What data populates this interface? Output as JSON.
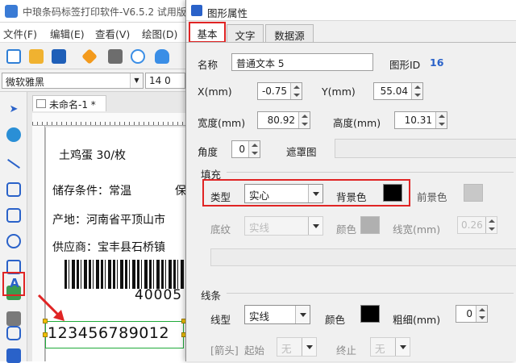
{
  "app": {
    "title": "中琅条码标签打印软件-V6.5.2 试用版",
    "menu": [
      "文件(F)",
      "编辑(E)",
      "查看(V)",
      "绘图(D)"
    ],
    "font_name": "微软雅黑",
    "font_size": "14 0",
    "doc_tab": "未命名-1 *",
    "label": {
      "line1": "土鸡蛋  30/枚",
      "line2": "储存条件：常温",
      "line2b": "保",
      "line3": "产地：河南省平顶山市",
      "line4": "供应商：宝丰县石桥镇",
      "barcode_digits": "40005",
      "selected_text": "123456789012"
    }
  },
  "dialog": {
    "title": "图形属性",
    "tabs": [
      "基本",
      "文字",
      "数据源"
    ],
    "name_label": "名称",
    "name_value": "普通文本 5",
    "id_label": "图形ID",
    "id_value": "16",
    "x_label": "X(mm)",
    "x_value": "-0.75",
    "y_label": "Y(mm)",
    "y_value": "55.04",
    "width_label": "宽度(mm)",
    "width_value": "80.92",
    "height_label": "高度(mm)",
    "height_value": "10.31",
    "angle_label": "角度",
    "angle_value": "0",
    "mask_label": "遮罩图",
    "fill_group": "填充",
    "fill_type_label": "类型",
    "fill_type_value": "实心",
    "bg_color_label": "背景色",
    "fg_color_label": "前景色",
    "pattern_label": "底纹",
    "pattern_value": "实线",
    "pattern_color_label": "颜色",
    "line_width_label": "线宽(mm)",
    "line_width_value": "0.26",
    "line_group": "线条",
    "line_type_label": "线型",
    "line_type_value": "实线",
    "line_color_label": "颜色",
    "thickness_label": "粗细(mm)",
    "thickness_value": "0",
    "arrow_label": "[箭头]",
    "start_label": "起始",
    "start_value": "无",
    "end_label": "终止",
    "end_value": "无",
    "colors": {
      "background": "#000000",
      "foreground": "#c8c8c8",
      "pattern": "#b0b0b0",
      "line": "#000000",
      "highlight": "#e02424",
      "id_value": "#2a62c9"
    }
  }
}
